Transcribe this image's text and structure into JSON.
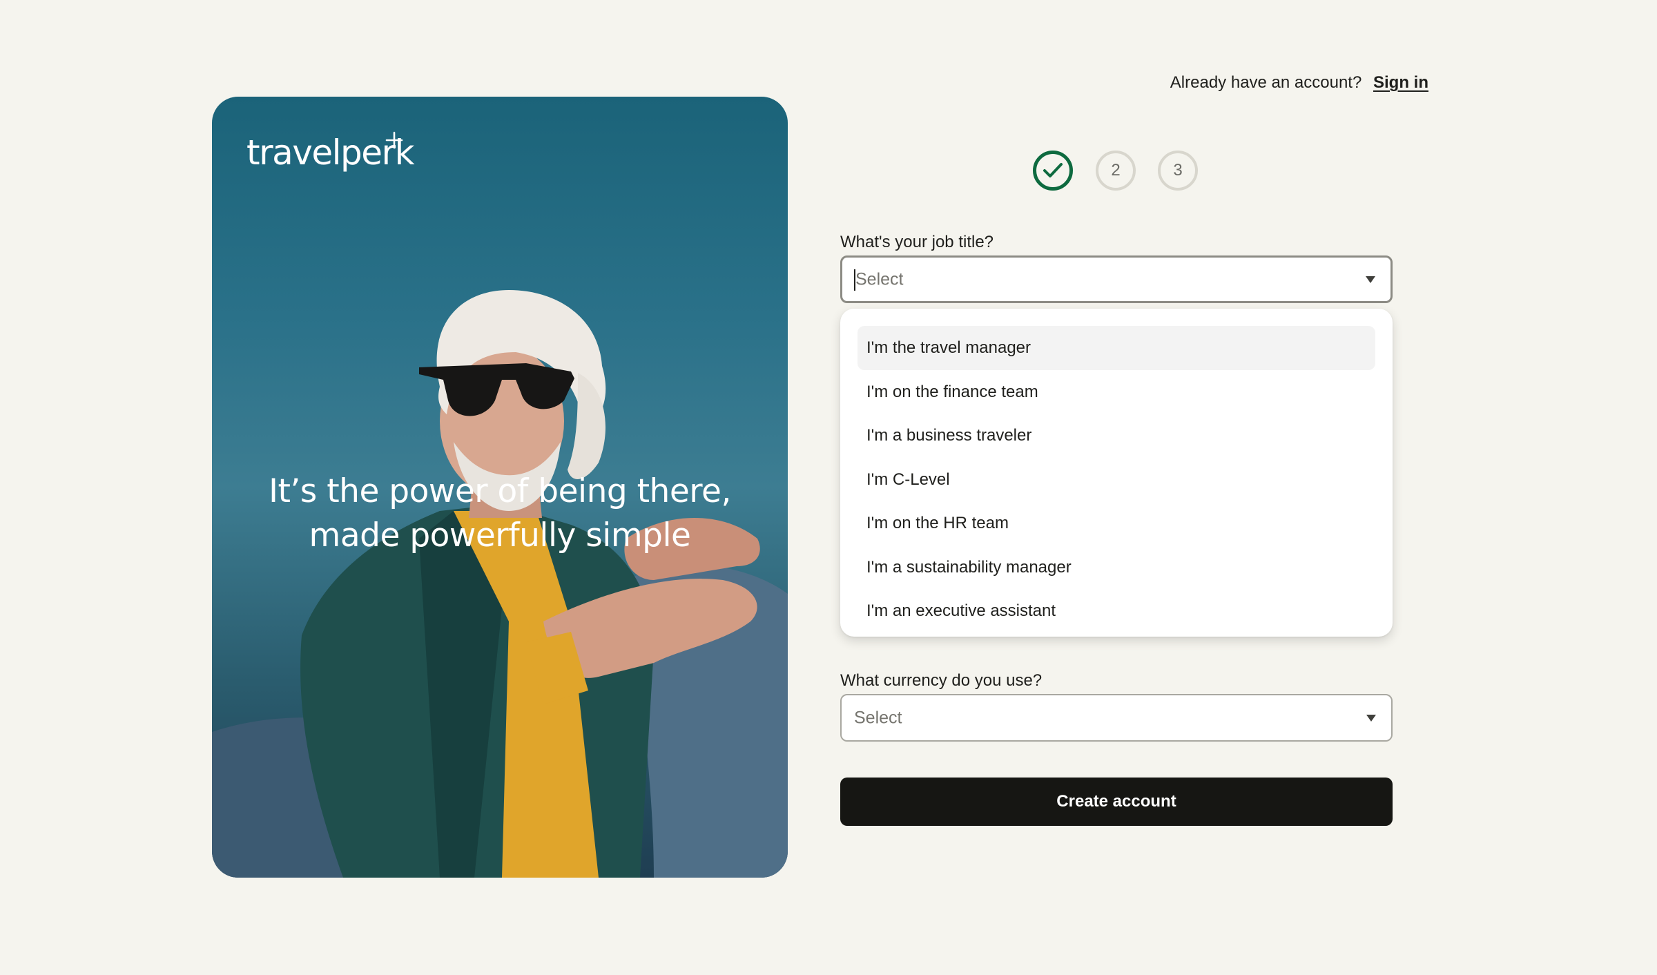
{
  "brand": {
    "logo_text": "travelperk",
    "tagline_line1": "It’s the power of being there,",
    "tagline_line2": "made powerfully simple"
  },
  "header": {
    "already_account_text": "Already have an account?",
    "sign_in_link": "Sign in"
  },
  "stepper": {
    "current_step": 1,
    "steps": [
      {
        "label": "1",
        "state": "complete",
        "icon": "check-icon"
      },
      {
        "label": "2",
        "state": "pending"
      },
      {
        "label": "3",
        "state": "pending"
      }
    ],
    "complete_color": "#0d6a3f"
  },
  "form": {
    "job_title": {
      "label": "What's your job title?",
      "placeholder": "Select",
      "value": "",
      "expanded": true,
      "options": [
        "I'm the travel manager",
        "I'm on the finance team",
        "I'm a business traveler",
        "I'm C-Level",
        "I'm on the HR team",
        "I'm a sustainability manager",
        "I'm an executive assistant"
      ],
      "highlighted_index": 0
    },
    "currency": {
      "label": "What currency do you use?",
      "placeholder": "Select",
      "value": ""
    },
    "submit_label": "Create account"
  },
  "colors": {
    "page_background": "#f5f4ee",
    "button_background": "#161613",
    "hero_blue": "#1b6379"
  }
}
